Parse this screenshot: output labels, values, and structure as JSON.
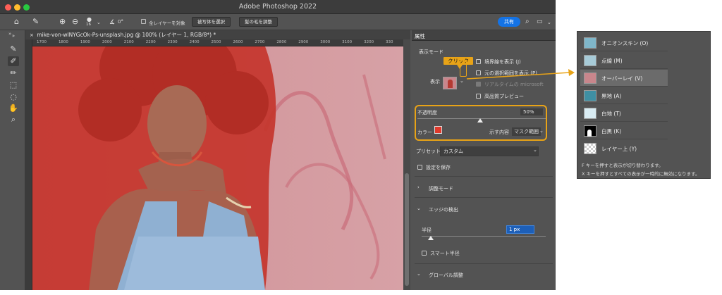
{
  "app": {
    "title": "Adobe Photoshop 2022"
  },
  "options_bar": {
    "brush_size": "16",
    "angle": "0°",
    "sample_all_layers": "全レイヤーを対象",
    "select_subject": "被写体を選択",
    "refine_hair": "髪の毛を調整",
    "share": "共有"
  },
  "document": {
    "tab_label": "mike-von-wlNYGcOk-Ps-unsplash.jpg @ 100% (レイヤー 1, RGB/8*) *",
    "ruler_ticks": [
      "1700",
      "1800",
      "1900",
      "2000",
      "2100",
      "2200",
      "2300",
      "2400",
      "2500",
      "2600",
      "2700",
      "2800",
      "2900",
      "3000",
      "3100",
      "3200",
      "330"
    ]
  },
  "properties": {
    "tab": "属性",
    "view_mode": {
      "section_title": "表示モード",
      "view_label": "表示",
      "show_edge": "境界線を表示 (J)",
      "show_original": "元の選択範囲を表示 (P)",
      "realtime_refine": "リアルタイムの microsoft",
      "high_quality_preview": "高品質プレビュー"
    },
    "opacity_label": "不透明度",
    "opacity_value": "50%",
    "opacity_fraction": 0.5,
    "color_label": "カラー",
    "color_value": "#e0392b",
    "indicates_label": "示す内容",
    "indicates_value": "マスク範囲",
    "preset_label": "プリセット",
    "preset_value": "カスタム",
    "remember_settings": "設定を保存",
    "adjust_mode": "調整モード",
    "edge_detection": "エッジの検出",
    "radius_label": "半径",
    "radius_value": "1 px",
    "smart_radius": "スマート半径",
    "global_refinements": "グローバル調整"
  },
  "callout": {
    "label": "クリック"
  },
  "view_mode_menu": {
    "items": [
      {
        "label": "オニオンスキン (O)",
        "highlighted": false
      },
      {
        "label": "点線 (M)",
        "highlighted": false
      },
      {
        "label": "オーバーレイ (V)",
        "highlighted": true
      },
      {
        "label": "黒地 (A)",
        "highlighted": false
      },
      {
        "label": "白地 (T)",
        "highlighted": false
      },
      {
        "label": "白黒 (K)",
        "highlighted": false
      },
      {
        "label": "レイヤー上 (Y)",
        "highlighted": false
      }
    ],
    "note_1": "F キーを押すと表示が切り替わります。",
    "note_2": "X キーを押すとすべての表示が一時的に無効になります。"
  },
  "colors": {
    "accent_orange": "#e8a317",
    "share_blue": "#1473e6",
    "overlay_red": "#c4352c",
    "panel_bg": "#535353"
  }
}
